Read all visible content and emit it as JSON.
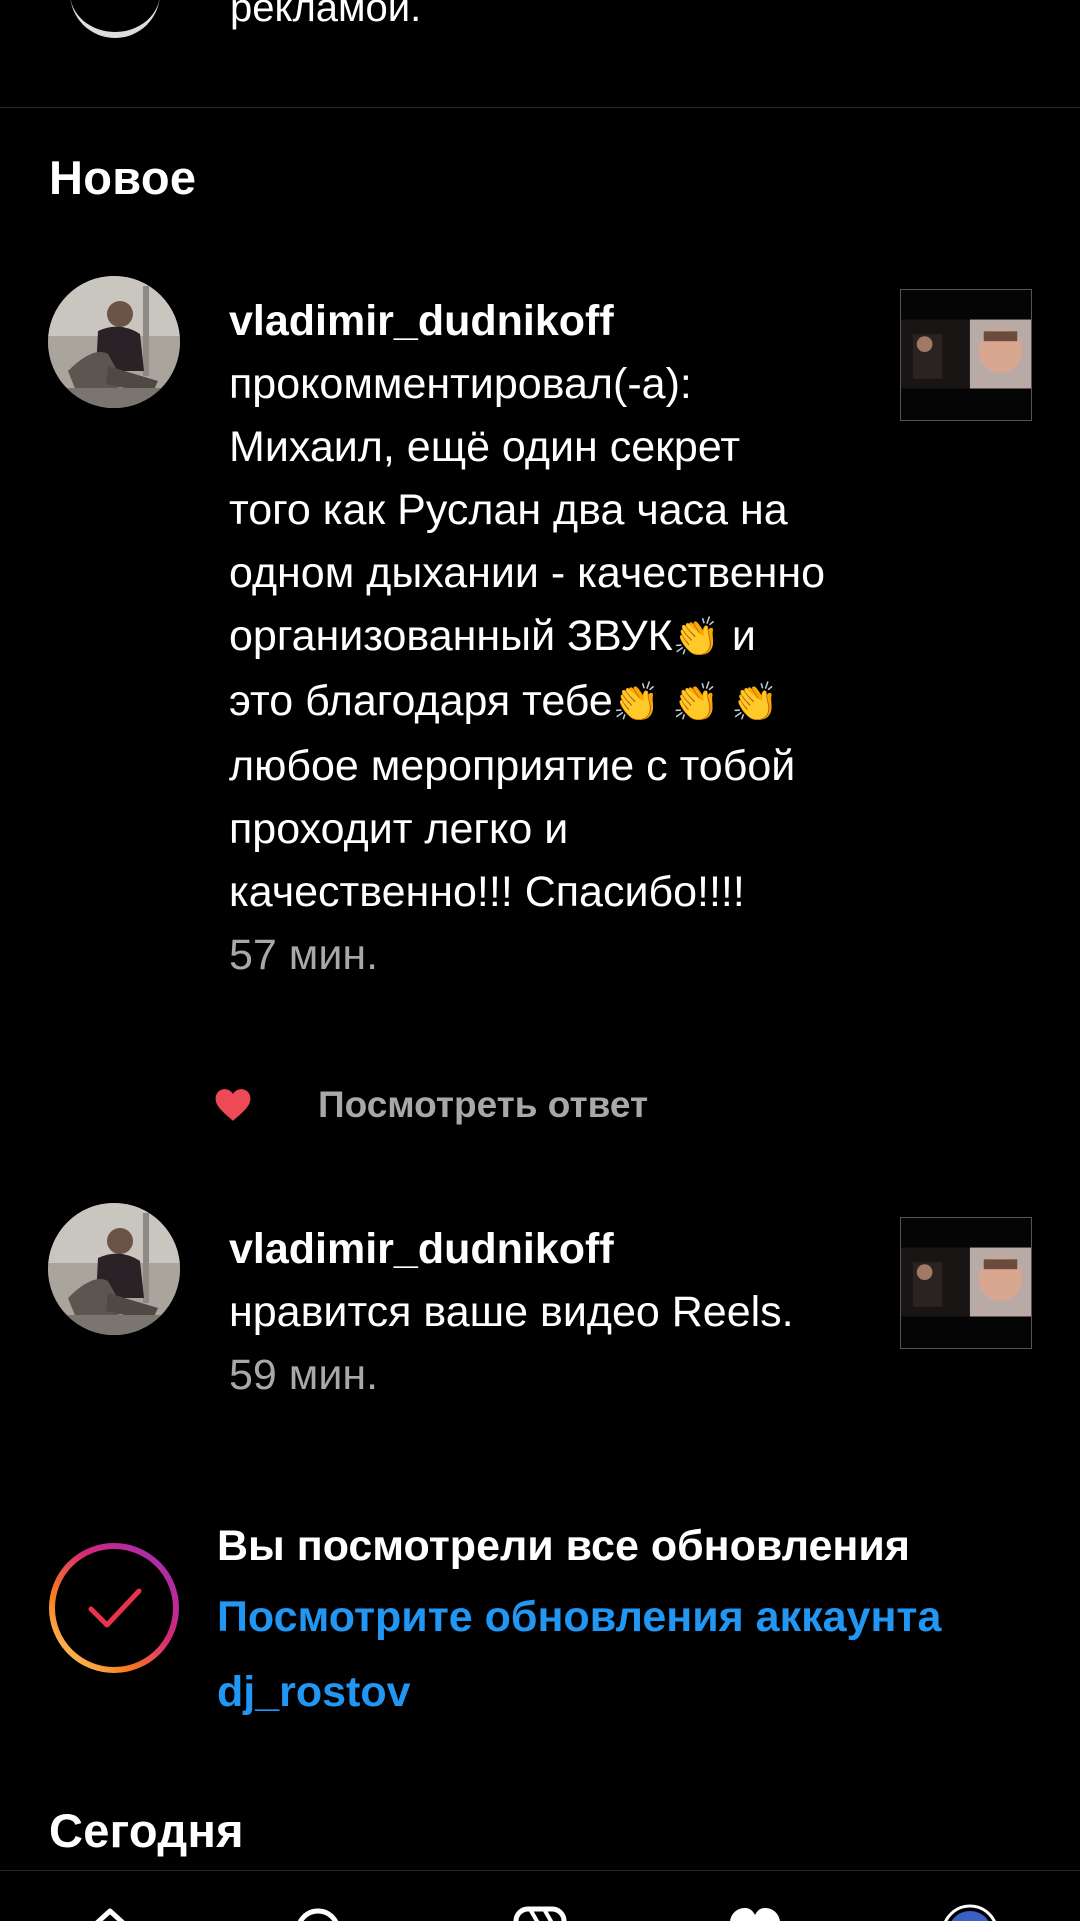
{
  "previous": {
    "text": "рекламой."
  },
  "sections": {
    "new_title": "Новое",
    "today_title": "Сегодня"
  },
  "notifications": [
    {
      "username": "vladimir_dudnikoff",
      "body_part1": "прокомментировал(-а): Михаил, ещё один секрет того как Руслан два часа на одном дыхании - качественно организованный ЗВУК",
      "body_part2": " и это благодаря тебе",
      "body_part3": " любое мероприятие с тобой проходит легко и качественно!!! Спасибо!!!!",
      "emoji": "👏",
      "time": "57 мин.",
      "reply_label": "Посмотреть ответ"
    },
    {
      "username": "vladimir_dudnikoff",
      "body": "нравится ваше видео Reels.",
      "time": "59 мин."
    }
  ],
  "caught_up": {
    "title": "Вы посмотрели все обновления",
    "link": "Посмотрите обновления аккаунта dj_rostov"
  },
  "colors": {
    "background": "#000000",
    "link": "#2196f3",
    "muted": "#a8a8a8",
    "heart": "#ed4956"
  },
  "icons": {
    "heart": "heart-icon",
    "check": "check-icon",
    "nav": [
      "home-icon",
      "search-icon",
      "reels-icon",
      "activity-heart-icon",
      "profile-avatar-icon"
    ]
  }
}
